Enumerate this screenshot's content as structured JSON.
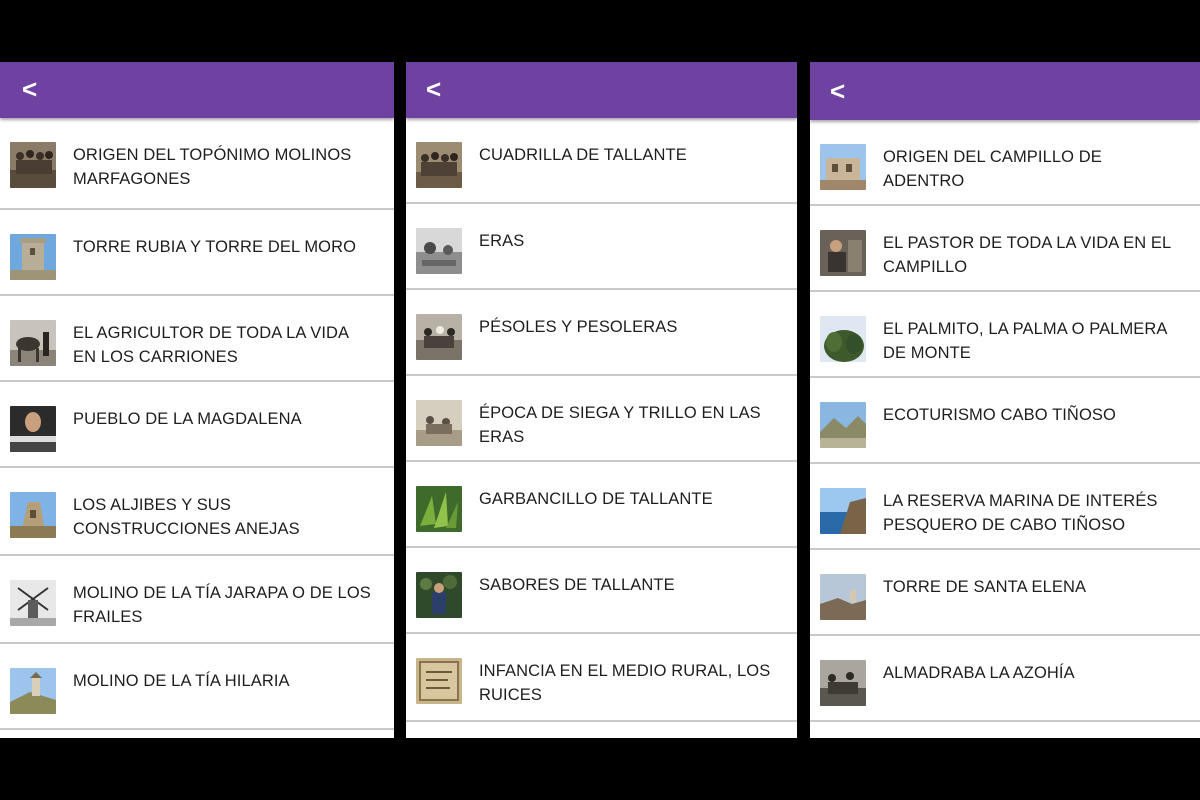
{
  "screens": [
    {
      "back_label": "<",
      "items": [
        {
          "label": "ORIGEN DEL TOPÓNIMO MOLINOS MARFAGONES",
          "thumb": "group-photo-sepia"
        },
        {
          "label": "TORRE RUBIA Y TORRE DEL MORO",
          "thumb": "stone-tower"
        },
        {
          "label": "EL AGRICULTOR DE TODA LA VIDA EN LOS CARRIONES",
          "thumb": "farmer-with-mule"
        },
        {
          "label": "PUEBLO DE LA MAGDALENA",
          "thumb": "portrait-man"
        },
        {
          "label": "LOS ALJIBES Y SUS CONSTRUCCIONES ANEJAS",
          "thumb": "ruined-cistern"
        },
        {
          "label": "MOLINO DE LA TÍA JARAPA O DE LOS FRAILES",
          "thumb": "windmill"
        },
        {
          "label": "MOLINO DE LA TÍA HILARIA",
          "thumb": "mill-on-hill"
        }
      ]
    },
    {
      "back_label": "<",
      "items": [
        {
          "label": "CUADRILLA DE TALLANTE",
          "thumb": "group-photo-sepia"
        },
        {
          "label": "ERAS",
          "thumb": "threshing-floor"
        },
        {
          "label": "PÉSOLES Y PESOLERAS",
          "thumb": "people-field"
        },
        {
          "label": "ÉPOCA DE SIEGA Y TRILLO EN LAS ERAS",
          "thumb": "harvest-photo"
        },
        {
          "label": "GARBANCILLO DE TALLANTE",
          "thumb": "green-plant"
        },
        {
          "label": "SABORES DE TALLANTE",
          "thumb": "market-stall"
        },
        {
          "label": "INFANCIA EN EL MEDIO RURAL, LOS RUICES",
          "thumb": "old-document"
        }
      ]
    },
    {
      "back_label": "<",
      "items": [
        {
          "label": "ORIGEN DEL CAMPILLO DE ADENTRO",
          "thumb": "ruined-house"
        },
        {
          "label": "EL PASTOR DE TODA LA VIDA EN EL CAMPILLO",
          "thumb": "shepherd"
        },
        {
          "label": "EL PALMITO, LA PALMA O PALMERA DE MONTE",
          "thumb": "palm-bush"
        },
        {
          "label": "ECOTURISMO CABO TIÑOSO",
          "thumb": "mountain-landscape"
        },
        {
          "label": "LA RESERVA MARINA DE INTERÉS PESQUERO DE CABO TIÑOSO",
          "thumb": "sea-cliff"
        },
        {
          "label": "TORRE DE SANTA ELENA",
          "thumb": "coastal-tower"
        },
        {
          "label": "ALMADRABA LA AZOHÍA",
          "thumb": "fishing-people"
        }
      ]
    }
  ],
  "colors": {
    "appbar": "#6f42a1",
    "divider": "#c9c9c9",
    "background": "#000000"
  }
}
